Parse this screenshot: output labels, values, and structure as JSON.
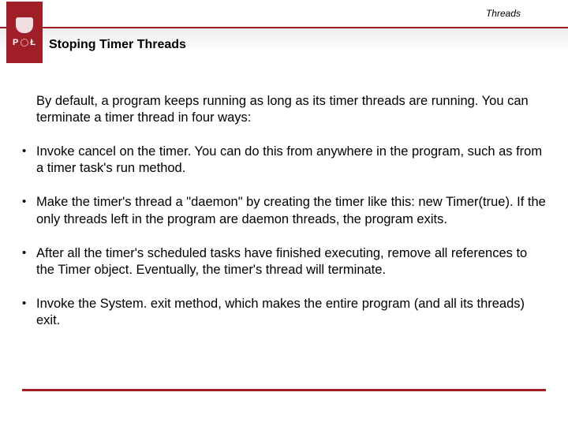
{
  "colors": {
    "accent": "#a01e28"
  },
  "header": {
    "category": "Threads",
    "logo_letters_left": "P",
    "logo_letters_right": "Ł",
    "title": "Stoping Timer Threads"
  },
  "content": {
    "intro": "By default, a program keeps running as long as its timer threads are running. You can terminate a timer thread in four ways:",
    "bullets": [
      "Invoke cancel on the timer. You can do this from anywhere in the program, such as from a timer task's run method.",
      "Make the timer's thread a \"daemon\" by creating the timer like this: new Timer(true). If the only threads left in the program are daemon threads, the program exits.",
      "After all the timer's scheduled tasks have finished executing, remove all references to the Timer object. Eventually, the timer's thread will terminate.",
      "Invoke the System. exit method, which makes the entire program (and all its threads) exit."
    ]
  }
}
